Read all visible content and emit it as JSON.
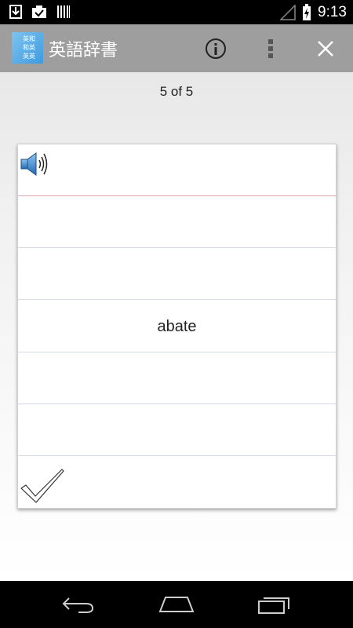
{
  "status_bar": {
    "time": "9:13",
    "icons": [
      "download-icon",
      "clipboard-check-icon",
      "barcode-icon",
      "signal-icon",
      "battery-charging-icon"
    ]
  },
  "action_bar": {
    "app_icon_text": [
      "英和",
      "和英",
      "英英"
    ],
    "title": "英語辞書",
    "actions": [
      "info-icon",
      "overflow-menu-icon",
      "close-icon"
    ],
    "background": "#9e9e9e"
  },
  "flashcard": {
    "counter": "5 of 5",
    "word": "abate",
    "speaker_icon": "speaker-icon",
    "check_icon": "checkmark-icon"
  },
  "nav_bar": {
    "buttons": [
      "back-icon",
      "home-icon",
      "recent-apps-icon"
    ]
  }
}
